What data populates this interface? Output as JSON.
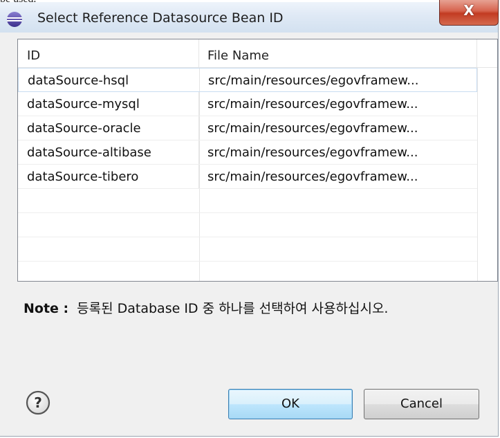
{
  "background": {
    "text": "be used."
  },
  "dialog": {
    "title": "Select Reference Datasource Bean ID",
    "close_label": "X"
  },
  "table": {
    "columns": [
      "ID",
      "File Name"
    ],
    "rows": [
      {
        "id": "dataSource-hsql",
        "file": "src/main/resources/egovframew..."
      },
      {
        "id": "dataSource-mysql",
        "file": "src/main/resources/egovframew..."
      },
      {
        "id": "dataSource-oracle",
        "file": "src/main/resources/egovframew..."
      },
      {
        "id": "dataSource-altibase",
        "file": "src/main/resources/egovframew..."
      },
      {
        "id": "dataSource-tibero",
        "file": "src/main/resources/egovframew..."
      }
    ],
    "selected_row": 0
  },
  "note": {
    "label": "Note :",
    "text": "등록된 Database ID 중 하나를 선택하여 사용하십시오."
  },
  "buttons": {
    "ok": "OK",
    "cancel": "Cancel"
  },
  "icons": {
    "title": "eclipse-icon",
    "help": "help-icon"
  },
  "colors": {
    "selection_border": "#c8dcf1",
    "ok_border": "#3c7fb1",
    "close_red": "#c23b22"
  }
}
